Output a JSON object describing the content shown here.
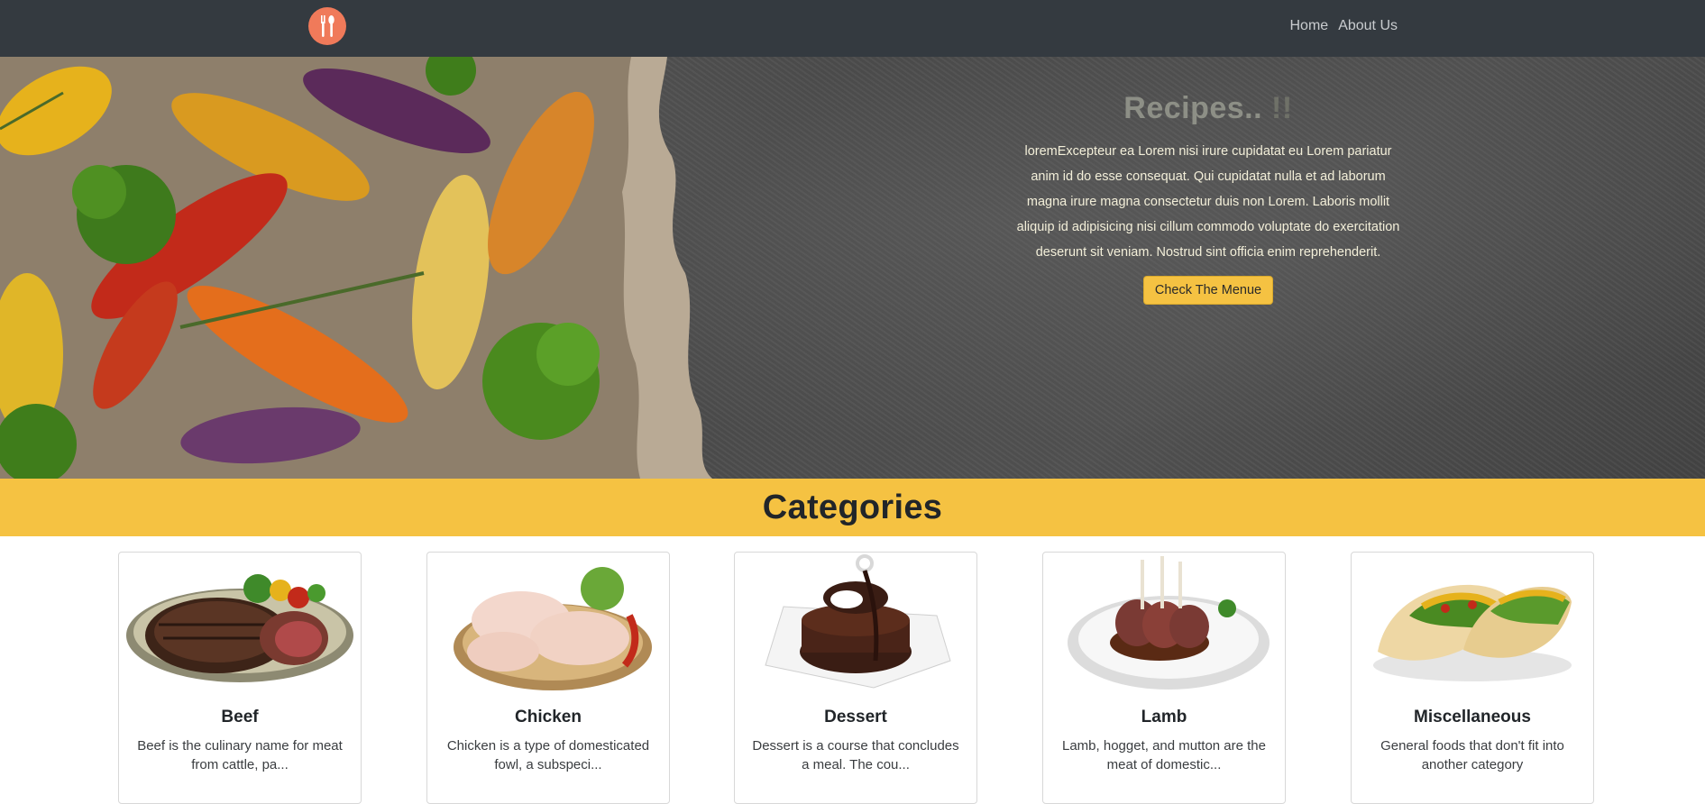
{
  "nav": {
    "logo_icon": "fork-spoon-icon",
    "links": [
      "Home",
      "About Us"
    ]
  },
  "hero": {
    "title": "Recipes..",
    "title_trailing": "!!",
    "text": "loremExcepteur ea Lorem nisi irure cupidatat eu Lorem pariatur anim id do esse consequat. Qui cupidatat nulla et ad laborum magna irure magna consectetur duis non Lorem. Laboris mollit aliquip id adipisicing nisi cillum commodo voluptate do exercitation deserunt sit veniam. Nostrud sint officia enim reprehenderit.",
    "button": "Check The Menue"
  },
  "categories": {
    "title": "Categories",
    "items": [
      {
        "name": "Beef",
        "description": "Beef is the culinary name for meat from cattle, pa..."
      },
      {
        "name": "Chicken",
        "description": "Chicken is a type of domesticated fowl, a subspeci..."
      },
      {
        "name": "Dessert",
        "description": "Dessert is a course that concludes a meal. The cou..."
      },
      {
        "name": "Lamb",
        "description": "Lamb, hogget, and mutton are the meat of domestic..."
      },
      {
        "name": "Miscellaneous",
        "description": "General foods that don't fit into another category"
      }
    ]
  },
  "colors": {
    "navbar": "#343a40",
    "accent": "#f5c242",
    "logo": "#f07a5a"
  }
}
